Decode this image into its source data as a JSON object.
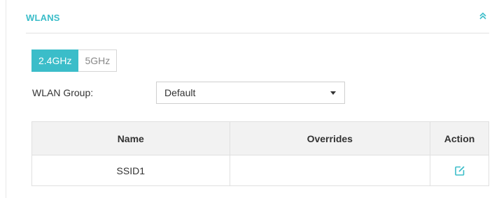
{
  "section": {
    "title": "WLANS",
    "collapse_icon": "double-chevron-up-icon"
  },
  "band_tabs": [
    {
      "label": "2.4GHz",
      "active": true
    },
    {
      "label": "5GHz",
      "active": false
    }
  ],
  "wlan_group": {
    "label": "WLAN Group:",
    "selected": "Default"
  },
  "table": {
    "columns": [
      "Name",
      "Overrides",
      "Action"
    ],
    "rows": [
      {
        "name": "SSID1",
        "overrides": "",
        "action_icon": "edit-icon"
      }
    ]
  },
  "colors": {
    "accent": "#3bbdc9",
    "header_bg": "#f2f2f2",
    "border": "#e0e0e0"
  }
}
